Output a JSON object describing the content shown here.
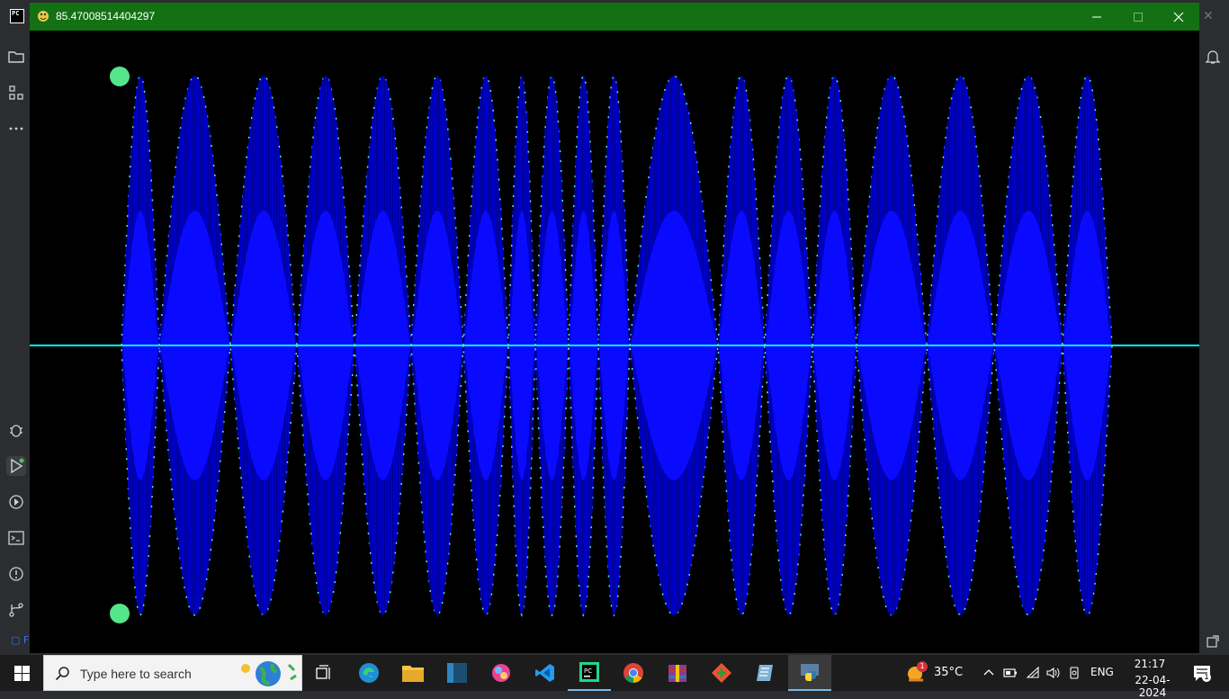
{
  "ide": {
    "logo_text": "PC",
    "bottom_label": "F"
  },
  "window": {
    "title": "85.47008514404297",
    "minimize_glyph": "—",
    "maximize_glyph": "☐",
    "close_glyph": "✕"
  },
  "visualization": {
    "background_color": "#000000",
    "wave_color": "#0000ff",
    "inner_wave_color": "#0a0aff",
    "envelope_color": "#5cf0c8",
    "axis_color": "#00ffff",
    "handle_color": "#55e68c",
    "lobe_count": 20
  },
  "taskbar": {
    "search_placeholder": "Type here to search",
    "apps": [
      "task-view",
      "edge",
      "file-explorer",
      "app-dark",
      "paint",
      "vscode",
      "pycharm",
      "chrome",
      "winrar",
      "git",
      "notepad",
      "python"
    ],
    "weather_temp": "35°C",
    "weather_badge": "1",
    "language": "ENG",
    "time": "21:17",
    "date": "22-04-2024",
    "notification_count": "1"
  }
}
